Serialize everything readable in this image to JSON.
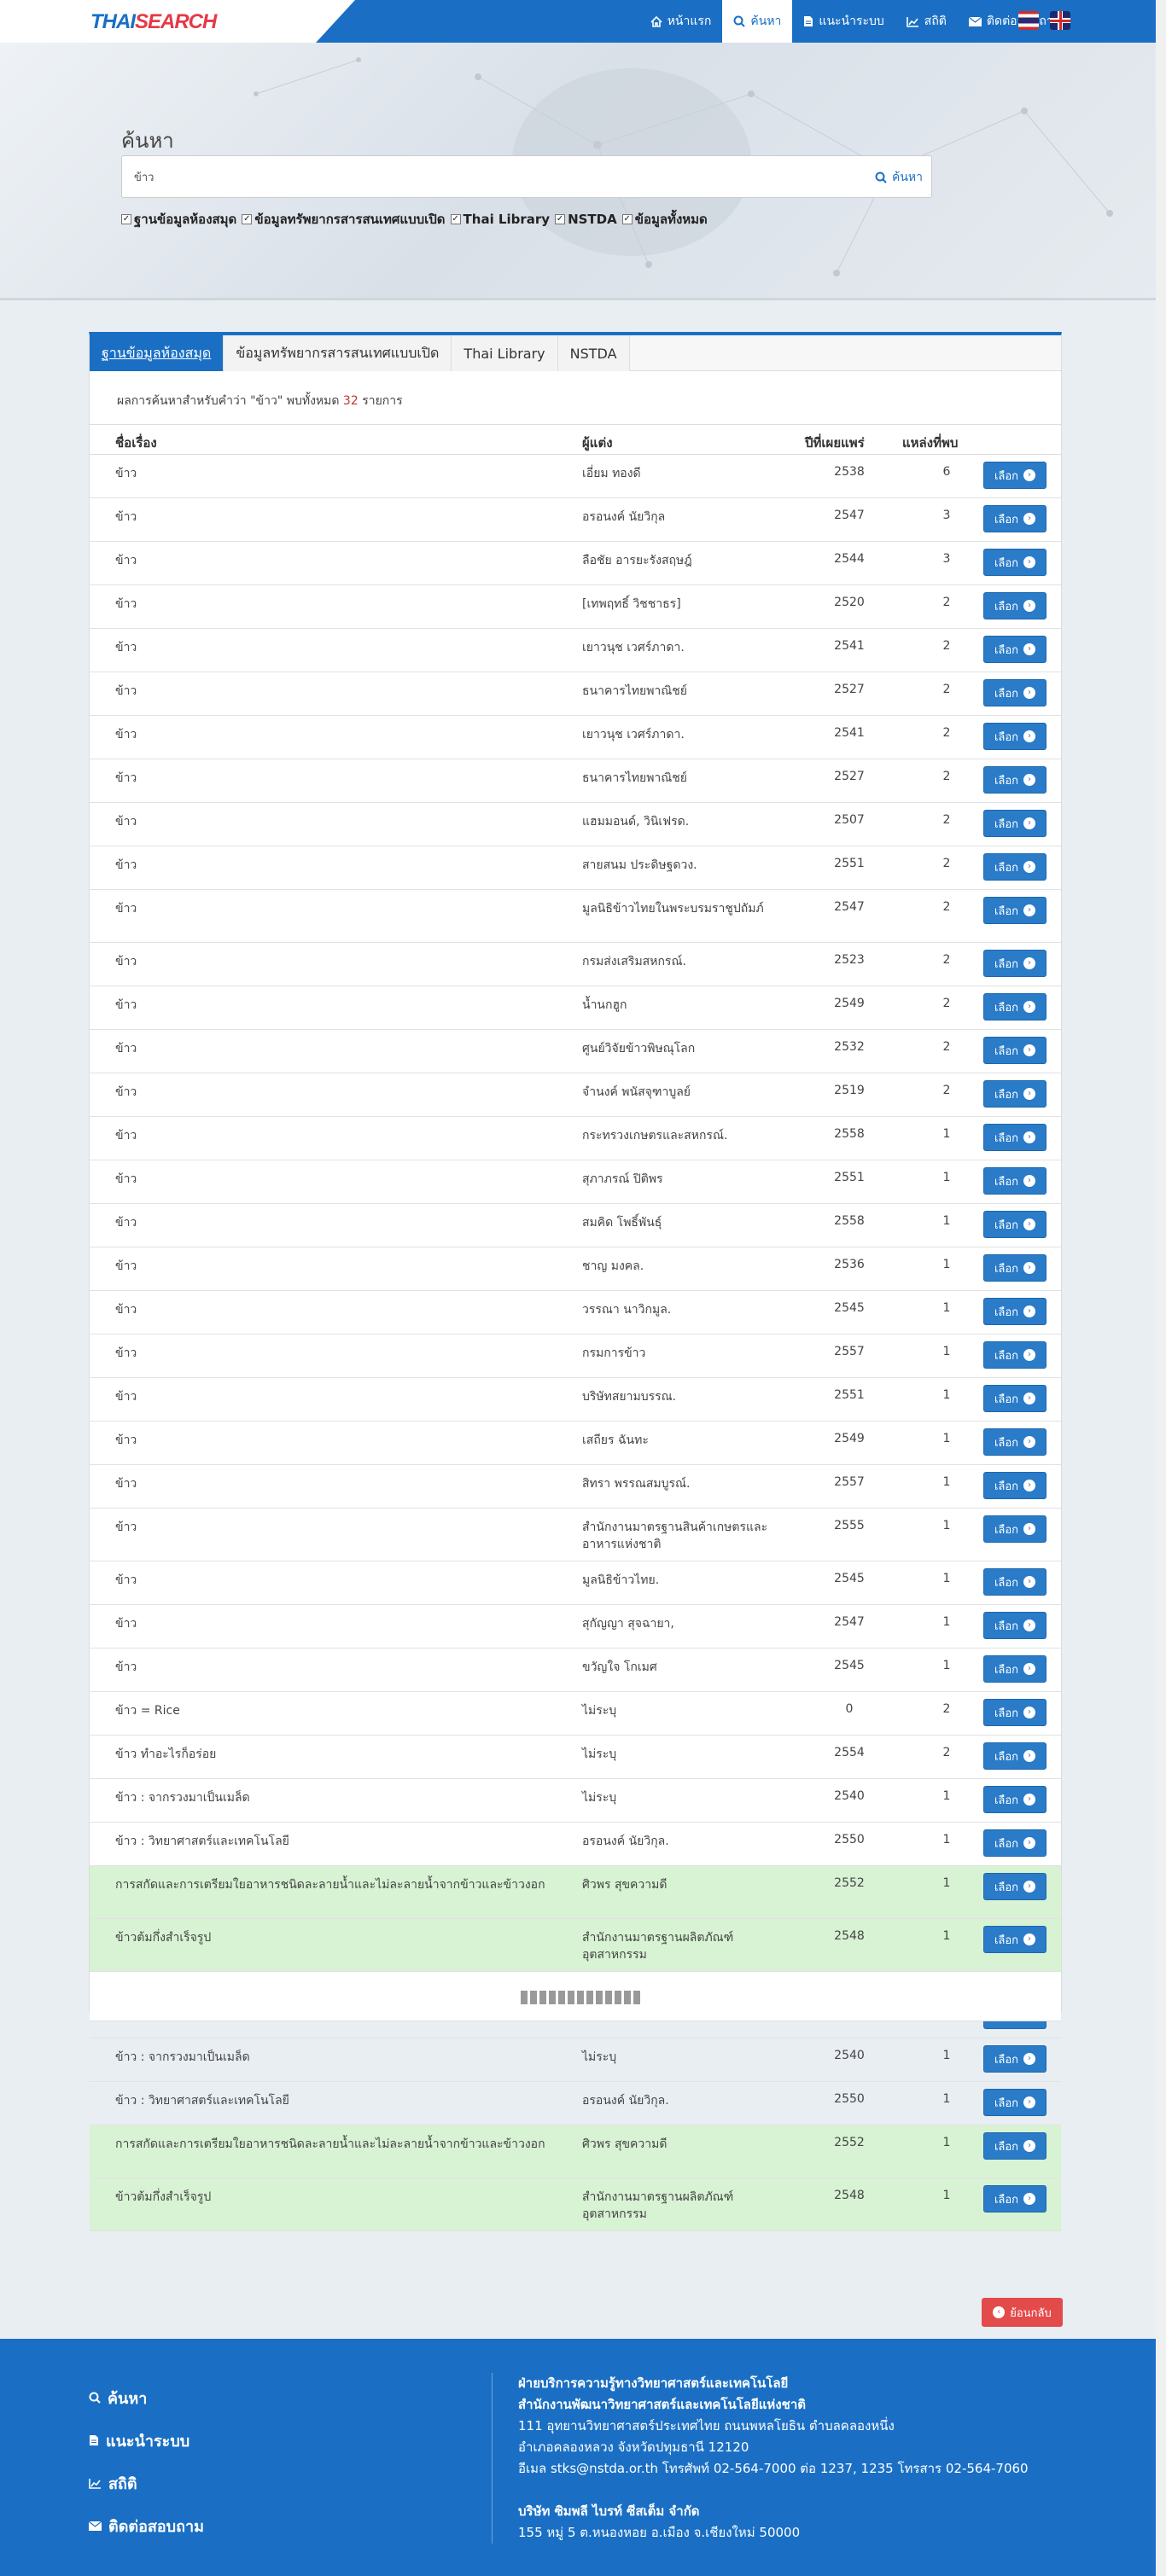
{
  "nav": {
    "logo_main": "THAI",
    "logo_accent": "SEARCH",
    "items": [
      {
        "label": "หน้าแรก",
        "icon": "home-icon"
      },
      {
        "label": "ค้นหา",
        "icon": "search-icon",
        "active": true
      },
      {
        "label": "แนะนำระบบ",
        "icon": "document-icon"
      },
      {
        "label": "สถิติ",
        "icon": "chart-icon"
      },
      {
        "label": "ติดต่อสอบถาม",
        "icon": "mail-icon"
      }
    ]
  },
  "hero": {
    "title": "ค้นหา",
    "search_value": "ข้าว",
    "search_button": "ค้นหา",
    "filters": [
      "ฐานข้อมูลห้องสมุด",
      "ข้อมูลทรัพยากรสารสนเทศแบบเปิด",
      "Thai Library",
      "NSTDA",
      "ข้อมูลทั้งหมด"
    ]
  },
  "results": {
    "tabs": [
      "ฐานข้อมูลห้องสมุด",
      "ข้อมูลทรัพยากรสารสนเทศแบบเปิด",
      "Thai Library",
      "NSTDA"
    ],
    "summary_prefix": "ผลการค้นหาสำหรับคำว่า \"ข้าว\" พบทั้งหมด",
    "summary_count": "32",
    "summary_suffix": "รายการ",
    "headers": {
      "title": "ชื่อเรื่อง",
      "author": "ผู้แต่ง",
      "year": "ปีที่เผยแพร่",
      "count": "แหล่งที่พบ"
    },
    "select_label": "เลือก",
    "rows": [
      {
        "title": "ข้าว",
        "author": "เอี่ยม ทองดี",
        "year": "2538",
        "count": "6"
      },
      {
        "title": "ข้าว",
        "author": "อรอนงค์ นัยวิกุล",
        "year": "2547",
        "count": "3"
      },
      {
        "title": "ข้าว",
        "author": "ลือชัย อารยะรังสฤษฎ์",
        "year": "2544",
        "count": "3"
      },
      {
        "title": "ข้าว",
        "author": "[เทพฤทธิ์ วิชชาธร]",
        "year": "2520",
        "count": "2"
      },
      {
        "title": "ข้าว",
        "author": "เยาวนุช เวศร์ภาดา.",
        "year": "2541",
        "count": "2"
      },
      {
        "title": "ข้าว",
        "author": "ธนาคารไทยพาณิชย์",
        "year": "2527",
        "count": "2"
      },
      {
        "title": "ข้าว",
        "author": "เยาวนุช เวศร์ภาดา.",
        "year": "2541",
        "count": "2"
      },
      {
        "title": "ข้าว",
        "author": "ธนาคารไทยพาณิชย์",
        "year": "2527",
        "count": "2"
      },
      {
        "title": "ข้าว",
        "author": "แฮมมอนด์, วินิเฟรด.",
        "year": "2507",
        "count": "2"
      },
      {
        "title": "ข้าว",
        "author": "สายสนม ประดิษฐดวง.",
        "year": "2551",
        "count": "2"
      },
      {
        "title": "ข้าว",
        "author": "มูลนิธิข้าวไทยในพระบรมราชูปถัมภ์",
        "year": "2547",
        "count": "2"
      },
      {
        "title": "ข้าว",
        "author": "กรมส่งเสริมสหกรณ์.",
        "year": "2523",
        "count": "2"
      },
      {
        "title": "ข้าว",
        "author": "น้ำนกฮูก",
        "year": "2549",
        "count": "2"
      },
      {
        "title": "ข้าว",
        "author": "ศูนย์วิจัยข้าวพิษณุโลก",
        "year": "2532",
        "count": "2"
      },
      {
        "title": "ข้าว",
        "author": "จำนงค์ พนัสจุฑาบูลย์",
        "year": "2519",
        "count": "2"
      },
      {
        "title": "ข้าว",
        "author": "กระทรวงเกษตรและสหกรณ์.",
        "year": "2558",
        "count": "1"
      },
      {
        "title": "ข้าว",
        "author": "สุภาภรณ์ ปิติพร",
        "year": "2551",
        "count": "1"
      },
      {
        "title": "ข้าว",
        "author": "สมคิด โพธิ์พันธุ์",
        "year": "2558",
        "count": "1"
      },
      {
        "title": "ข้าว",
        "author": "ชาญ มงคล.",
        "year": "2536",
        "count": "1"
      },
      {
        "title": "ข้าว",
        "author": "วรรณา นาวิกมูล.",
        "year": "2545",
        "count": "1"
      },
      {
        "title": "ข้าว",
        "author": "กรมการข้าว",
        "year": "2557",
        "count": "1"
      },
      {
        "title": "ข้าว",
        "author": "บริษัทสยามบรรณ.",
        "year": "2551",
        "count": "1"
      },
      {
        "title": "ข้าว",
        "author": "เสถียร ฉันทะ",
        "year": "2549",
        "count": "1"
      },
      {
        "title": "ข้าว",
        "author": "สิทรา พรรณสมบูรณ์.",
        "year": "2557",
        "count": "1"
      },
      {
        "title": "ข้าว",
        "author": "สำนักงานมาตรฐานสินค้าเกษตรและอาหารแห่งชาติ",
        "year": "2555",
        "count": "1"
      },
      {
        "title": "ข้าว",
        "author": "มูลนิธิข้าวไทย.",
        "year": "2545",
        "count": "1"
      },
      {
        "title": "ข้าว",
        "author": "สุกัญญา สุจฉายา,",
        "year": "2547",
        "count": "1"
      },
      {
        "title": "ข้าว",
        "author": "ขวัญใจ โกเมศ",
        "year": "2545",
        "count": "1"
      },
      {
        "title": "ข้าว = Rice",
        "author": "ไม่ระบุ",
        "year": "0",
        "count": "2"
      },
      {
        "title": "ข้าว ทำอะไรก็อร่อย",
        "author": "ไม่ระบุ",
        "year": "2554",
        "count": "2"
      },
      {
        "title": "ข้าว : จากรวงมาเป็นเมล็ด",
        "author": "ไม่ระบุ",
        "year": "2540",
        "count": "1"
      },
      {
        "title": "ข้าว : วิทยาศาสตร์และเทคโนโลยี",
        "author": "อรอนงค์ นัยวิกุล.",
        "year": "2550",
        "count": "1"
      },
      {
        "title": "การสกัดและการเตรียมใยอาหารชนิดละลายน้ำและไม่ละลายน้ำจากข้าวและข้าวงอก",
        "author": "ศิวพร สุขความดี",
        "year": "2552",
        "count": "1",
        "highlight": true
      },
      {
        "title": "ข้าวต้มกึ่งสำเร็จรูป",
        "author": "สำนักงานมาตรฐานผลิตภัณฑ์อุตสาหกรรม",
        "year": "2548",
        "count": "1",
        "highlight": true
      }
    ],
    "repeat_rows": [
      {
        "title": "ข้าว ทำอะไรก็อร่อย",
        "author": "ไม่ระบุ",
        "year": "2554",
        "count": "2"
      },
      {
        "title": "ข้าว : จากรวงมาเป็นเมล็ด",
        "author": "ไม่ระบุ",
        "year": "2540",
        "count": "1"
      },
      {
        "title": "ข้าว : วิทยาศาสตร์และเทคโนโลยี",
        "author": "อรอนงค์ นัยวิกุล.",
        "year": "2550",
        "count": "1"
      },
      {
        "title": "การสกัดและการเตรียมใยอาหารชนิดละลายน้ำและไม่ละลายน้ำจากข้าวและข้าวงอก",
        "author": "ศิวพร สุขความดี",
        "year": "2552",
        "count": "1",
        "highlight": true
      },
      {
        "title": "ข้าวต้มกึ่งสำเร็จรูป",
        "author": "สำนักงานมาตรฐานผลิตภัณฑ์อุตสาหกรรม",
        "year": "2548",
        "count": "1",
        "highlight": true
      }
    ],
    "back_label": "ย้อนกลับ"
  },
  "footer": {
    "links": [
      {
        "label": "ค้นหา",
        "icon": "search-icon"
      },
      {
        "label": "แนะนำระบบ",
        "icon": "document-icon"
      },
      {
        "label": "สถิติ",
        "icon": "chart-icon"
      },
      {
        "label": "ติดต่อสอบถาม",
        "icon": "mail-icon"
      }
    ],
    "org1": "ฝ่ายบริการความรู้ทางวิทยาศาสตร์และเทคโนโลยี",
    "org2": "สำนักงานพัฒนาวิทยาศาสตร์และเทคโนโลยีแห่งชาติ",
    "addr1": "111 อุทยานวิทยาศาสตร์ประเทศไทย ถนนพหลโยธิน ตำบลคลองหนึ่ง",
    "addr2": "อำเภอคลองหลวง จังหวัดปทุมธานี 12120",
    "contact": "อีเมล stks@nstda.or.th โทรศัพท์ 02-564-7000 ต่อ 1237, 1235 โทรสาร 02-564-7060",
    "company": "บริษัท ซิมพลี ไบรท์ ซีสเต็ม จำกัด",
    "company_addr": "155 หมู่ 5 ต.หนองหอย อ.เมือง จ.เชียงใหม่ 50000"
  },
  "colors": {
    "primary": "#1a6fc4",
    "highlight": "#d7f3d3",
    "danger": "#e34b4b"
  }
}
